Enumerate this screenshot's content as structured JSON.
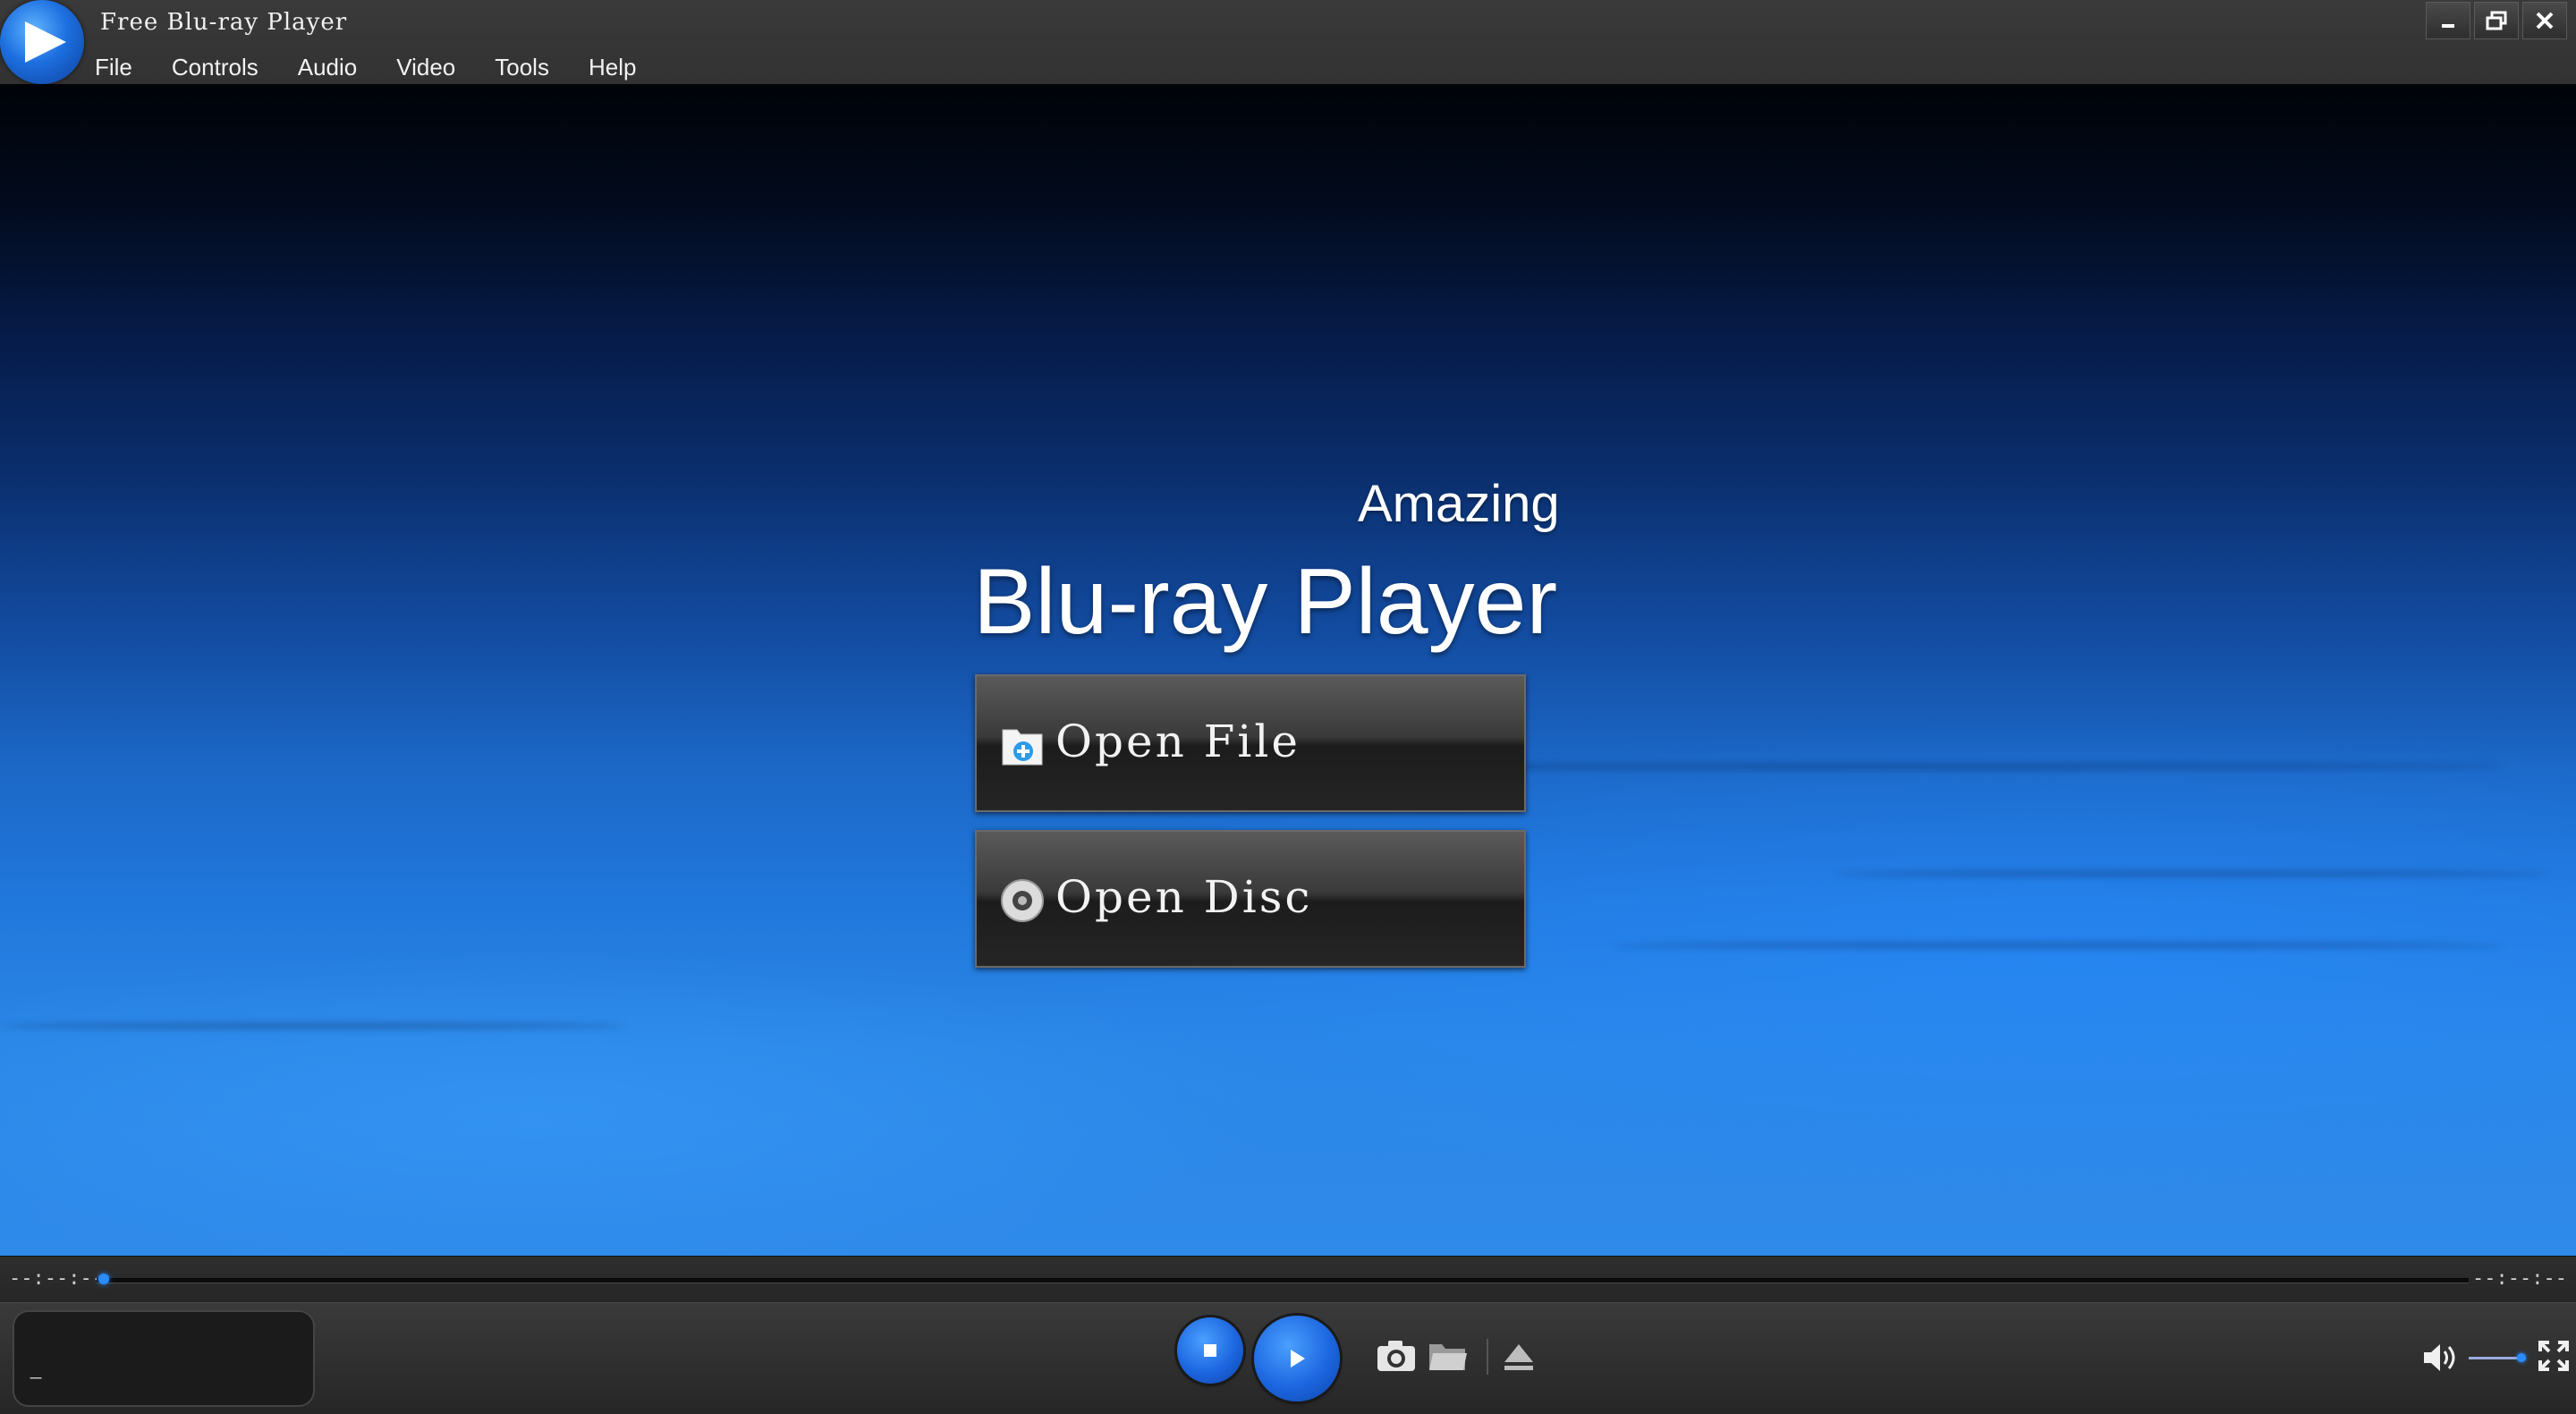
{
  "window": {
    "title": "Free Blu-ray Player",
    "controls": [
      "minimize-icon",
      "restore-icon",
      "close-icon"
    ]
  },
  "menu": {
    "items": [
      {
        "label": "File"
      },
      {
        "label": "Controls"
      },
      {
        "label": "Audio"
      },
      {
        "label": "Video"
      },
      {
        "label": "Tools"
      },
      {
        "label": "Help"
      }
    ]
  },
  "stage": {
    "tagline": "Amazing",
    "product": "Blu-ray Player",
    "open_file_label": "Open File",
    "open_disc_label": "Open Disc"
  },
  "progress": {
    "elapsed": "--:--:--",
    "remaining": "--:--:--",
    "position": 0
  },
  "controls": {
    "info_text": "_",
    "volume_level": 0.85,
    "icons": [
      "stop-icon",
      "play-icon",
      "camera-icon",
      "folder-icon",
      "eject-icon",
      "volume-icon",
      "fullscreen-icon"
    ]
  },
  "colors": {
    "accent": "#1f6fe6",
    "titlebar": "#353535",
    "text": "#ffffff"
  }
}
